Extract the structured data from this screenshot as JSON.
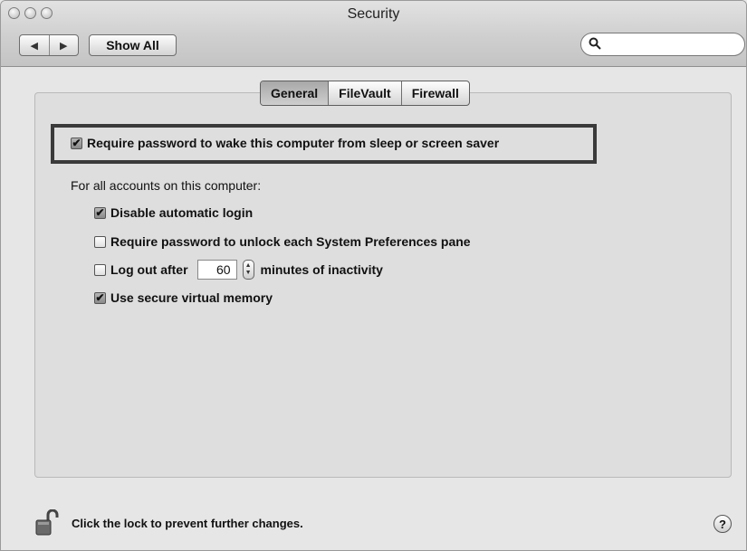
{
  "window": {
    "title": "Security"
  },
  "toolbar": {
    "back_glyph": "◀",
    "forward_glyph": "▶",
    "show_all_label": "Show All",
    "search_placeholder": "",
    "search_glyph": "🔍"
  },
  "tabs": [
    {
      "label": "General",
      "selected": true
    },
    {
      "label": "FileVault",
      "selected": false
    },
    {
      "label": "Firewall",
      "selected": false
    }
  ],
  "general": {
    "require_wake_password": {
      "label": "Require password to wake this computer from sleep or screen saver",
      "checked": true
    },
    "accounts_header": "For all accounts on this computer:",
    "options": [
      {
        "label": "Disable automatic login",
        "checked": true
      },
      {
        "label": "Require password to unlock each System Preferences pane",
        "checked": false
      }
    ],
    "logout": {
      "label_before": "Log out after",
      "minutes": "60",
      "label_after": "minutes of inactivity",
      "checked": false
    },
    "secure_vm": {
      "label": "Use secure virtual memory",
      "checked": true
    }
  },
  "footer": {
    "lock_text": "Click the lock to prevent further changes.",
    "help_label": "?"
  },
  "icons": {
    "lock": "lock-open-icon",
    "help": "help-icon",
    "search": "magnifier-icon"
  }
}
